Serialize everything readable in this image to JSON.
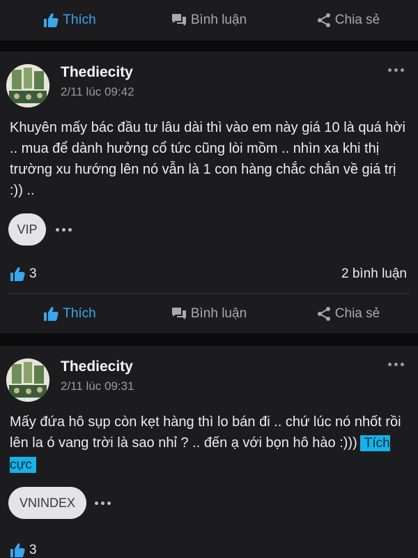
{
  "actions": {
    "like_label": "Thích",
    "comment_label": "Bình luận",
    "share_label": "Chia sẻ"
  },
  "posts": [
    {
      "username": "Thediecity",
      "time": "2/11 lúc 09:42",
      "content": "Khuyên mấy bác đầu tư lâu dài thì vào em này giá 10 là quá hời .. mua để dành hưởng cổ tức cũng lòi mồm .. nhìn xa khi thị trường xu hướng lên nó vẫn là 1 con hàng chắc chắn về giá trị :)) ..",
      "chip": "VIP",
      "likes": "3",
      "comments": "2 bình luận"
    },
    {
      "username": "Thediecity",
      "time": "2/11 lúc 09:31",
      "content": "Mấy đứa hô sụp còn kẹt hàng thì lo bán đi .. chứ lúc nó nhốt rồi lên la ó vang trời là sao nhỉ ? .. đến ạ với bọn hô hào :)))",
      "sentiment_tag": "Tích cực",
      "chip": "VNINDEX",
      "likes": "3"
    }
  ],
  "colors": {
    "background": "#0b0b0c",
    "card": "#1c1c1e",
    "accent_blue": "#3aa6f0",
    "tag_bg": "#16b2e8"
  },
  "icons": {
    "like": "thumbs-up-icon",
    "comment": "comment-icon",
    "share": "share-icon",
    "more": "more-horizontal-icon"
  }
}
